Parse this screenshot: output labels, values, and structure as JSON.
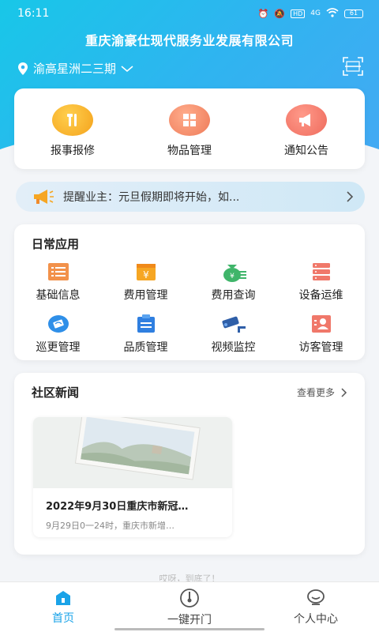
{
  "status_bar": {
    "time": "16:11",
    "battery": "61",
    "network": "4G"
  },
  "header": {
    "company": "重庆渝豪仕现代服务业发展有限公司",
    "location": "渝高星洲二三期"
  },
  "quick_actions": [
    {
      "label": "报事报修",
      "icon": "repair-tools-icon",
      "color": "#f6a623"
    },
    {
      "label": "物品管理",
      "icon": "grid-box-icon",
      "color": "#f08a6a"
    },
    {
      "label": "通知公告",
      "icon": "megaphone-icon",
      "color": "#f0786a"
    }
  ],
  "notice": {
    "text": "提醒业主：元旦假期即将开始，如..."
  },
  "daily_apps": {
    "title": "日常应用",
    "items": [
      {
        "label": "基础信息",
        "icon": "document-list-icon"
      },
      {
        "label": "费用管理",
        "icon": "yuan-wallet-icon"
      },
      {
        "label": "费用查询",
        "icon": "money-bag-icon"
      },
      {
        "label": "设备运维",
        "icon": "server-stack-icon"
      },
      {
        "label": "巡更管理",
        "icon": "patrol-tag-icon"
      },
      {
        "label": "品质管理",
        "icon": "clipboard-icon"
      },
      {
        "label": "视频监控",
        "icon": "camera-icon"
      },
      {
        "label": "访客管理",
        "icon": "visitor-card-icon"
      }
    ]
  },
  "news": {
    "title": "社区新闻",
    "more_label": "查看更多",
    "items": [
      {
        "title": "2022年9月30日重庆市新冠…",
        "summary": "9月29日0一24时，重庆市新增…"
      }
    ]
  },
  "footer_text": "哎呀，到底了！",
  "tabs": [
    {
      "label": "首页",
      "active": true
    },
    {
      "label": "一键开门",
      "active": false
    },
    {
      "label": "个人中心",
      "active": false
    }
  ],
  "colors": {
    "accent": "#1aa3e8",
    "gradient_start": "#18c7e8",
    "gradient_end": "#4aa6f4"
  }
}
